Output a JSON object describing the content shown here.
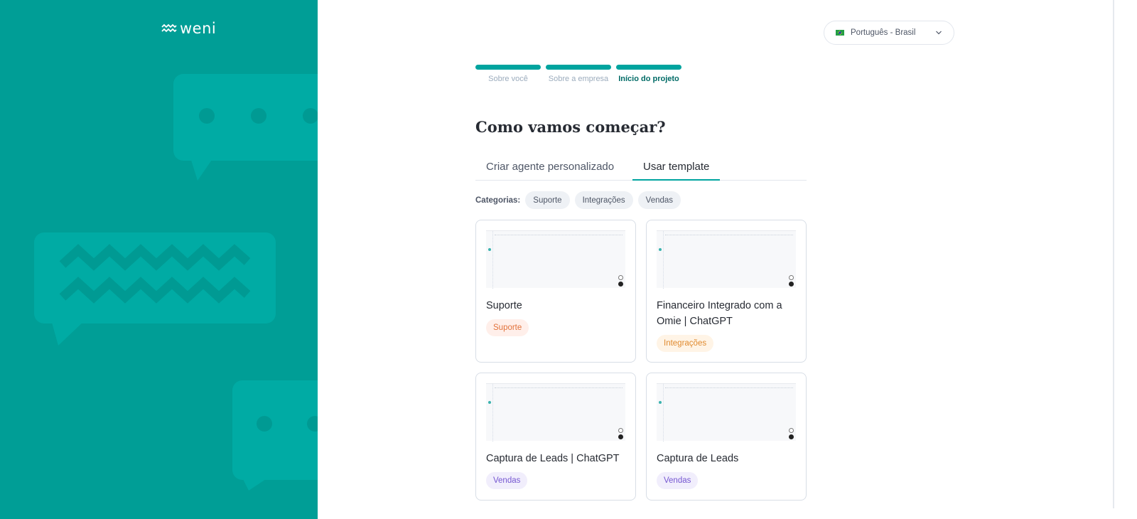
{
  "brand": {
    "name": "weni",
    "panel_color": "#009E96"
  },
  "language": {
    "flag_icon": "brazil-flag-icon",
    "label": "Português - Brasil"
  },
  "steps": [
    {
      "label": "Sobre você",
      "active": false
    },
    {
      "label": "Sobre a empresa",
      "active": false
    },
    {
      "label": "Início do projeto",
      "active": true
    }
  ],
  "title": "Como vamos começar?",
  "tabs": [
    {
      "label": "Criar agente personalizado",
      "selected": false
    },
    {
      "label": "Usar template",
      "selected": true
    }
  ],
  "categories": {
    "label": "Categorias:",
    "items": [
      "Suporte",
      "Integrações",
      "Vendas"
    ]
  },
  "templates": [
    {
      "title": "Suporte",
      "tag": "Suporte"
    },
    {
      "title": "Financeiro Integrado com a Omie | ChatGPT",
      "tag": "Integrações"
    },
    {
      "title": "Captura de Leads | ChatGPT",
      "tag": "Vendas"
    },
    {
      "title": "Captura de Leads",
      "tag": "Vendas"
    }
  ],
  "colors": {
    "accent": "#00A49F",
    "border": "#D8DEE6"
  }
}
